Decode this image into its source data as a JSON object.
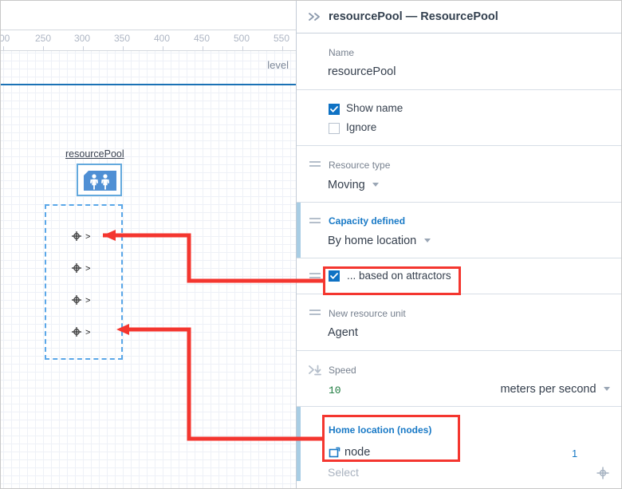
{
  "canvas": {
    "ruler_labels": [
      "00",
      "250",
      "300",
      "350",
      "400",
      "450",
      "500",
      "550"
    ],
    "level_label": "level",
    "resource_pool_label": "resourcePool",
    "node_markers": [
      {
        "label": ">"
      },
      {
        "label": ">"
      },
      {
        "label": ">"
      },
      {
        "label": ">"
      }
    ]
  },
  "panel": {
    "header": {
      "title": "resourcePool — ResourcePool",
      "expand_icon": "double-chevron-right-icon"
    },
    "name_section": {
      "label": "Name",
      "value": "resourcePool"
    },
    "flags_section": {
      "show_name": {
        "label": "Show name",
        "checked": true
      },
      "ignore": {
        "label": "Ignore",
        "checked": false
      }
    },
    "resource_type_section": {
      "label": "Resource type",
      "value": "Moving"
    },
    "capacity_section": {
      "label": "Capacity defined",
      "value": "By home location"
    },
    "attractors_section": {
      "label": "... based on attractors",
      "checked": true,
      "highlighted": true
    },
    "new_resource_unit_section": {
      "label": "New resource unit",
      "value": "Agent"
    },
    "speed_section": {
      "label": "Speed",
      "value": "10",
      "unit": "meters per second"
    },
    "home_location_section": {
      "label": "Home location (nodes)",
      "value": "node",
      "count": "1",
      "placeholder": "Select",
      "node_icon": "node-shape-icon",
      "picker_icon": "crosshair-target-icon",
      "highlighted": true
    }
  },
  "colors": {
    "accent_blue": "#1879c6",
    "highlight_red": "#f4362f",
    "checkbox_blue": "#0f72c4",
    "level_line_blue": "#1b72b5",
    "selection_blue": "#5aa7e8",
    "green_value": "#1b7a3d"
  }
}
